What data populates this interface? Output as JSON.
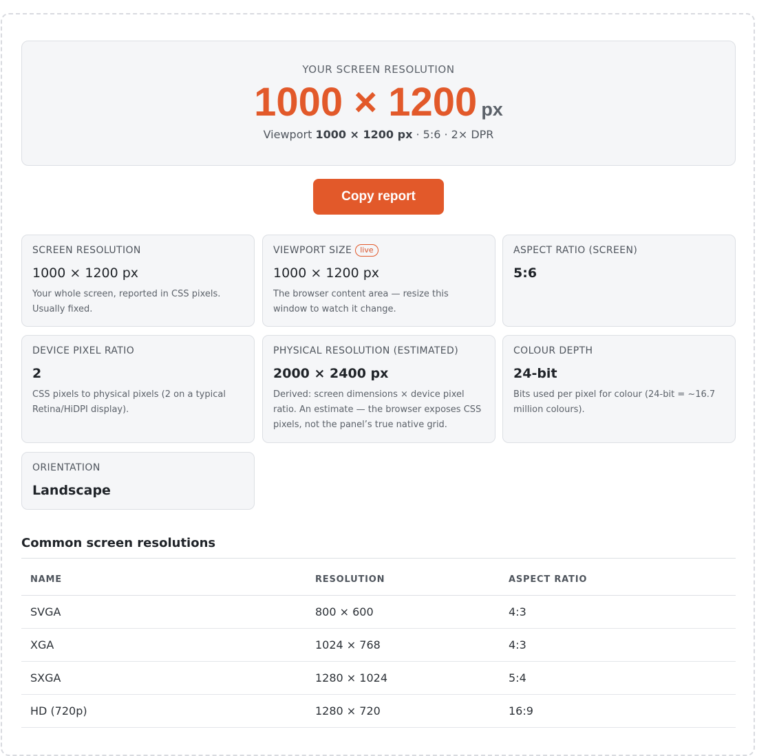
{
  "hero": {
    "label": "YOUR SCREEN RESOLUTION",
    "value": "1000 × 1200",
    "unit": "px",
    "sub_prefix": "Viewport",
    "sub_viewport": "1000 × 1200 px",
    "sub_suffix": "· 5:6 · 2× DPR"
  },
  "copy_button": {
    "label": "Copy report"
  },
  "cards": {
    "screen_resolution": {
      "label": "SCREEN RESOLUTION",
      "value": "1000 × 1200 px",
      "desc": "Your whole screen, reported in CSS pixels. Usually fixed."
    },
    "viewport_size": {
      "label": "VIEWPORT SIZE",
      "badge": "live",
      "value": "1000 × 1200 px",
      "desc": "The browser content area — resize this window to watch it change."
    },
    "aspect_ratio": {
      "label": "ASPECT RATIO (SCREEN)",
      "value": "5:6"
    },
    "device_pixel_ratio": {
      "label": "DEVICE PIXEL RATIO",
      "value": "2",
      "desc": "CSS pixels to physical pixels (2 on a typical Retina/HiDPI display)."
    },
    "physical_resolution": {
      "label": "PHYSICAL RESOLUTION (ESTIMATED)",
      "value": "2000 × 2400 px",
      "desc": "Derived: screen dimensions × device pixel ratio. An estimate — the browser exposes CSS pixels, not the panel’s true native grid."
    },
    "colour_depth": {
      "label": "COLOUR DEPTH",
      "value": "24-bit",
      "desc": "Bits used per pixel for colour (24-bit = ~16.7 million colours)."
    },
    "orientation": {
      "label": "ORIENTATION",
      "value": "Landscape"
    }
  },
  "common": {
    "title": "Common screen resolutions",
    "headers": [
      "NAME",
      "RESOLUTION",
      "ASPECT RATIO"
    ],
    "rows": [
      [
        "SVGA",
        "800 × 600",
        "4:3"
      ],
      [
        "XGA",
        "1024 × 768",
        "4:3"
      ],
      [
        "SXGA",
        "1280 × 1024",
        "5:4"
      ],
      [
        "HD (720p)",
        "1280 × 720",
        "16:9"
      ]
    ]
  },
  "colors": {
    "accent": "#e2592a",
    "card_bg": "#f5f6f8",
    "border": "#dcdfe4"
  }
}
